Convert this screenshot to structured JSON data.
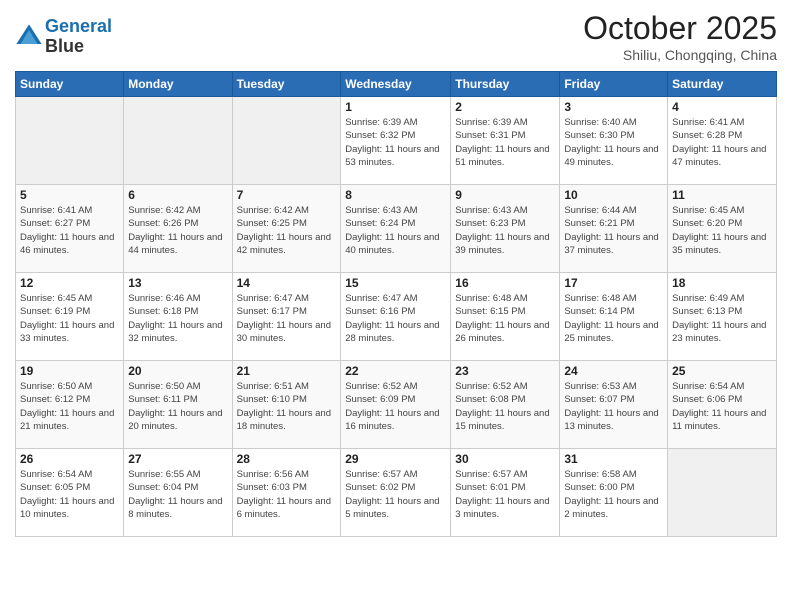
{
  "header": {
    "logo_line1": "General",
    "logo_line2": "Blue",
    "month": "October 2025",
    "location": "Shiliu, Chongqing, China"
  },
  "weekdays": [
    "Sunday",
    "Monday",
    "Tuesday",
    "Wednesday",
    "Thursday",
    "Friday",
    "Saturday"
  ],
  "weeks": [
    [
      {
        "day": "",
        "info": ""
      },
      {
        "day": "",
        "info": ""
      },
      {
        "day": "",
        "info": ""
      },
      {
        "day": "1",
        "info": "Sunrise: 6:39 AM\nSunset: 6:32 PM\nDaylight: 11 hours and 53 minutes."
      },
      {
        "day": "2",
        "info": "Sunrise: 6:39 AM\nSunset: 6:31 PM\nDaylight: 11 hours and 51 minutes."
      },
      {
        "day": "3",
        "info": "Sunrise: 6:40 AM\nSunset: 6:30 PM\nDaylight: 11 hours and 49 minutes."
      },
      {
        "day": "4",
        "info": "Sunrise: 6:41 AM\nSunset: 6:28 PM\nDaylight: 11 hours and 47 minutes."
      }
    ],
    [
      {
        "day": "5",
        "info": "Sunrise: 6:41 AM\nSunset: 6:27 PM\nDaylight: 11 hours and 46 minutes."
      },
      {
        "day": "6",
        "info": "Sunrise: 6:42 AM\nSunset: 6:26 PM\nDaylight: 11 hours and 44 minutes."
      },
      {
        "day": "7",
        "info": "Sunrise: 6:42 AM\nSunset: 6:25 PM\nDaylight: 11 hours and 42 minutes."
      },
      {
        "day": "8",
        "info": "Sunrise: 6:43 AM\nSunset: 6:24 PM\nDaylight: 11 hours and 40 minutes."
      },
      {
        "day": "9",
        "info": "Sunrise: 6:43 AM\nSunset: 6:23 PM\nDaylight: 11 hours and 39 minutes."
      },
      {
        "day": "10",
        "info": "Sunrise: 6:44 AM\nSunset: 6:21 PM\nDaylight: 11 hours and 37 minutes."
      },
      {
        "day": "11",
        "info": "Sunrise: 6:45 AM\nSunset: 6:20 PM\nDaylight: 11 hours and 35 minutes."
      }
    ],
    [
      {
        "day": "12",
        "info": "Sunrise: 6:45 AM\nSunset: 6:19 PM\nDaylight: 11 hours and 33 minutes."
      },
      {
        "day": "13",
        "info": "Sunrise: 6:46 AM\nSunset: 6:18 PM\nDaylight: 11 hours and 32 minutes."
      },
      {
        "day": "14",
        "info": "Sunrise: 6:47 AM\nSunset: 6:17 PM\nDaylight: 11 hours and 30 minutes."
      },
      {
        "day": "15",
        "info": "Sunrise: 6:47 AM\nSunset: 6:16 PM\nDaylight: 11 hours and 28 minutes."
      },
      {
        "day": "16",
        "info": "Sunrise: 6:48 AM\nSunset: 6:15 PM\nDaylight: 11 hours and 26 minutes."
      },
      {
        "day": "17",
        "info": "Sunrise: 6:48 AM\nSunset: 6:14 PM\nDaylight: 11 hours and 25 minutes."
      },
      {
        "day": "18",
        "info": "Sunrise: 6:49 AM\nSunset: 6:13 PM\nDaylight: 11 hours and 23 minutes."
      }
    ],
    [
      {
        "day": "19",
        "info": "Sunrise: 6:50 AM\nSunset: 6:12 PM\nDaylight: 11 hours and 21 minutes."
      },
      {
        "day": "20",
        "info": "Sunrise: 6:50 AM\nSunset: 6:11 PM\nDaylight: 11 hours and 20 minutes."
      },
      {
        "day": "21",
        "info": "Sunrise: 6:51 AM\nSunset: 6:10 PM\nDaylight: 11 hours and 18 minutes."
      },
      {
        "day": "22",
        "info": "Sunrise: 6:52 AM\nSunset: 6:09 PM\nDaylight: 11 hours and 16 minutes."
      },
      {
        "day": "23",
        "info": "Sunrise: 6:52 AM\nSunset: 6:08 PM\nDaylight: 11 hours and 15 minutes."
      },
      {
        "day": "24",
        "info": "Sunrise: 6:53 AM\nSunset: 6:07 PM\nDaylight: 11 hours and 13 minutes."
      },
      {
        "day": "25",
        "info": "Sunrise: 6:54 AM\nSunset: 6:06 PM\nDaylight: 11 hours and 11 minutes."
      }
    ],
    [
      {
        "day": "26",
        "info": "Sunrise: 6:54 AM\nSunset: 6:05 PM\nDaylight: 11 hours and 10 minutes."
      },
      {
        "day": "27",
        "info": "Sunrise: 6:55 AM\nSunset: 6:04 PM\nDaylight: 11 hours and 8 minutes."
      },
      {
        "day": "28",
        "info": "Sunrise: 6:56 AM\nSunset: 6:03 PM\nDaylight: 11 hours and 6 minutes."
      },
      {
        "day": "29",
        "info": "Sunrise: 6:57 AM\nSunset: 6:02 PM\nDaylight: 11 hours and 5 minutes."
      },
      {
        "day": "30",
        "info": "Sunrise: 6:57 AM\nSunset: 6:01 PM\nDaylight: 11 hours and 3 minutes."
      },
      {
        "day": "31",
        "info": "Sunrise: 6:58 AM\nSunset: 6:00 PM\nDaylight: 11 hours and 2 minutes."
      },
      {
        "day": "",
        "info": ""
      }
    ]
  ]
}
